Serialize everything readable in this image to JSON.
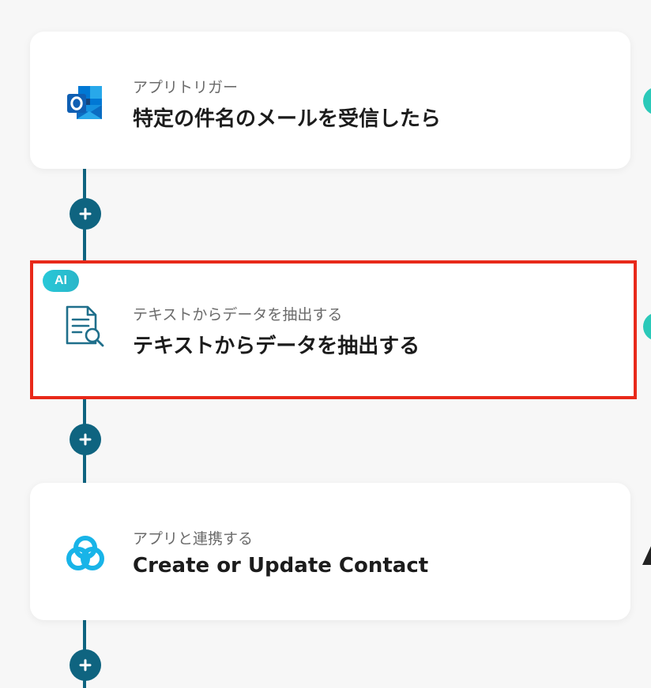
{
  "flow": {
    "steps": [
      {
        "kind": "trigger",
        "subtitle": "アプリトリガー",
        "title": "特定の件名のメールを受信したら",
        "icon": "outlook-icon"
      },
      {
        "kind": "ai",
        "badge": "AI",
        "subtitle": "テキストからデータを抽出する",
        "title": "テキストからデータを抽出する",
        "icon": "document-search-icon",
        "highlighted": true
      },
      {
        "kind": "app",
        "subtitle": "アプリと連携する",
        "title": "Create or Update Contact",
        "icon": "app-logo-icon"
      }
    ],
    "add_step_icon": "plus-icon",
    "colors": {
      "connector": "#0f6480",
      "highlight": "#e8291a",
      "ai_badge": "#28c8d8",
      "edge_badge": "#2bc9b9"
    }
  }
}
